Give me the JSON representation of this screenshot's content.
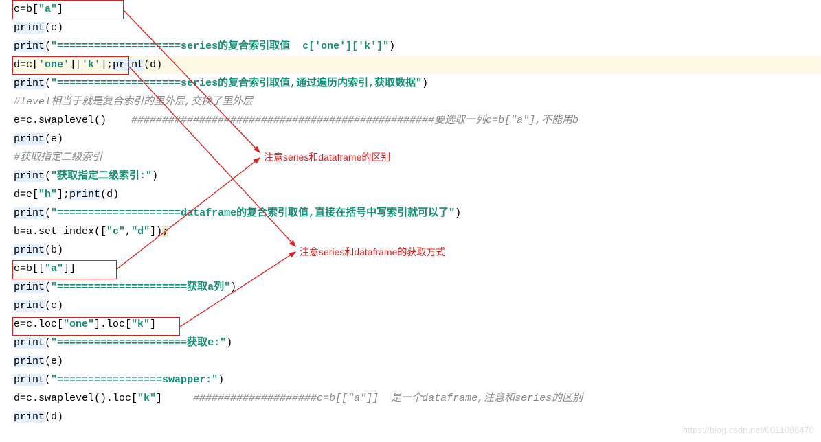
{
  "lines": {
    "l1_a": "c=b[",
    "l1_b": "\"a\"",
    "l1_c": "]",
    "l2_a": "print",
    "l2_b": "(c)",
    "l3_a": "print",
    "l3_b": "(",
    "l3_c": "\"====================series的复合索引取值  c['one']['k']\"",
    "l3_d": ")",
    "l4_a": "d=c[",
    "l4_b": "'one'",
    "l4_c": "][",
    "l4_d": "'k'",
    "l4_e": "];",
    "l4_f": "print",
    "l4_g": "(d)",
    "l5_a": "print",
    "l5_b": "(",
    "l5_c": "\"====================series的复合索引取值,通过遍历内索引,获取数据\"",
    "l5_d": ")",
    "l6": "#level相当于就是复合索引的里外层,交换了里外层",
    "l7_a": "e=c.swaplevel()    ",
    "l7_b": "#################################################要选取一列c=b[\"a\"],不能用b",
    "l8_a": "print",
    "l8_b": "(e)",
    "l9": "#获取指定二级索引",
    "l10_a": "print",
    "l10_b": "(",
    "l10_c": "\"获取指定二级索引:\"",
    "l10_d": ")",
    "l11_a": "d=e[",
    "l11_b": "\"h\"",
    "l11_c": "];",
    "l11_d": "print",
    "l11_e": "(d)",
    "l12_a": "print",
    "l12_b": "(",
    "l12_c": "\"====================dataframe的复合索引取值,直接在括号中写索引就可以了\"",
    "l12_d": ")",
    "l13_a": "b=a.set_index([",
    "l13_b": "\"c\"",
    "l13_c": ",",
    "l13_d": "\"d\"",
    "l13_e": "])",
    "l13_f": ";",
    "l14_a": "print",
    "l14_b": "(b)",
    "l15_a": "c=b[[",
    "l15_b": "\"a\"",
    "l15_c": "]]",
    "l16_a": "print",
    "l16_b": "(",
    "l16_c": "\"=====================获取a列\"",
    "l16_d": ")",
    "l17_a": "print",
    "l17_b": "(c)",
    "l18_a": "e=c.loc[",
    "l18_b": "\"one\"",
    "l18_c": "].loc[",
    "l18_d": "\"k\"",
    "l18_e": "]",
    "l19_a": "print",
    "l19_b": "(",
    "l19_c": "\"=====================获取e:\"",
    "l19_d": ")",
    "l20_a": "print",
    "l20_b": "(e)",
    "l21_a": "print",
    "l21_b": "(",
    "l21_c": "\"=================swapper:\"",
    "l21_d": ")",
    "l22_a": "d=c.swaplevel().loc[",
    "l22_b": "\"k\"",
    "l22_c": "]     ",
    "l22_d": "####################c=b[[\"a\"]]  是一个dataframe,注意和series的区别",
    "l23_a": "print",
    "l23_b": "(d)"
  },
  "annotations": {
    "note1": "注意series和dataframe的区别",
    "note2": "注意series和dataframe的获取方式"
  },
  "watermark": "https://blog.csdn.net/0011086470"
}
